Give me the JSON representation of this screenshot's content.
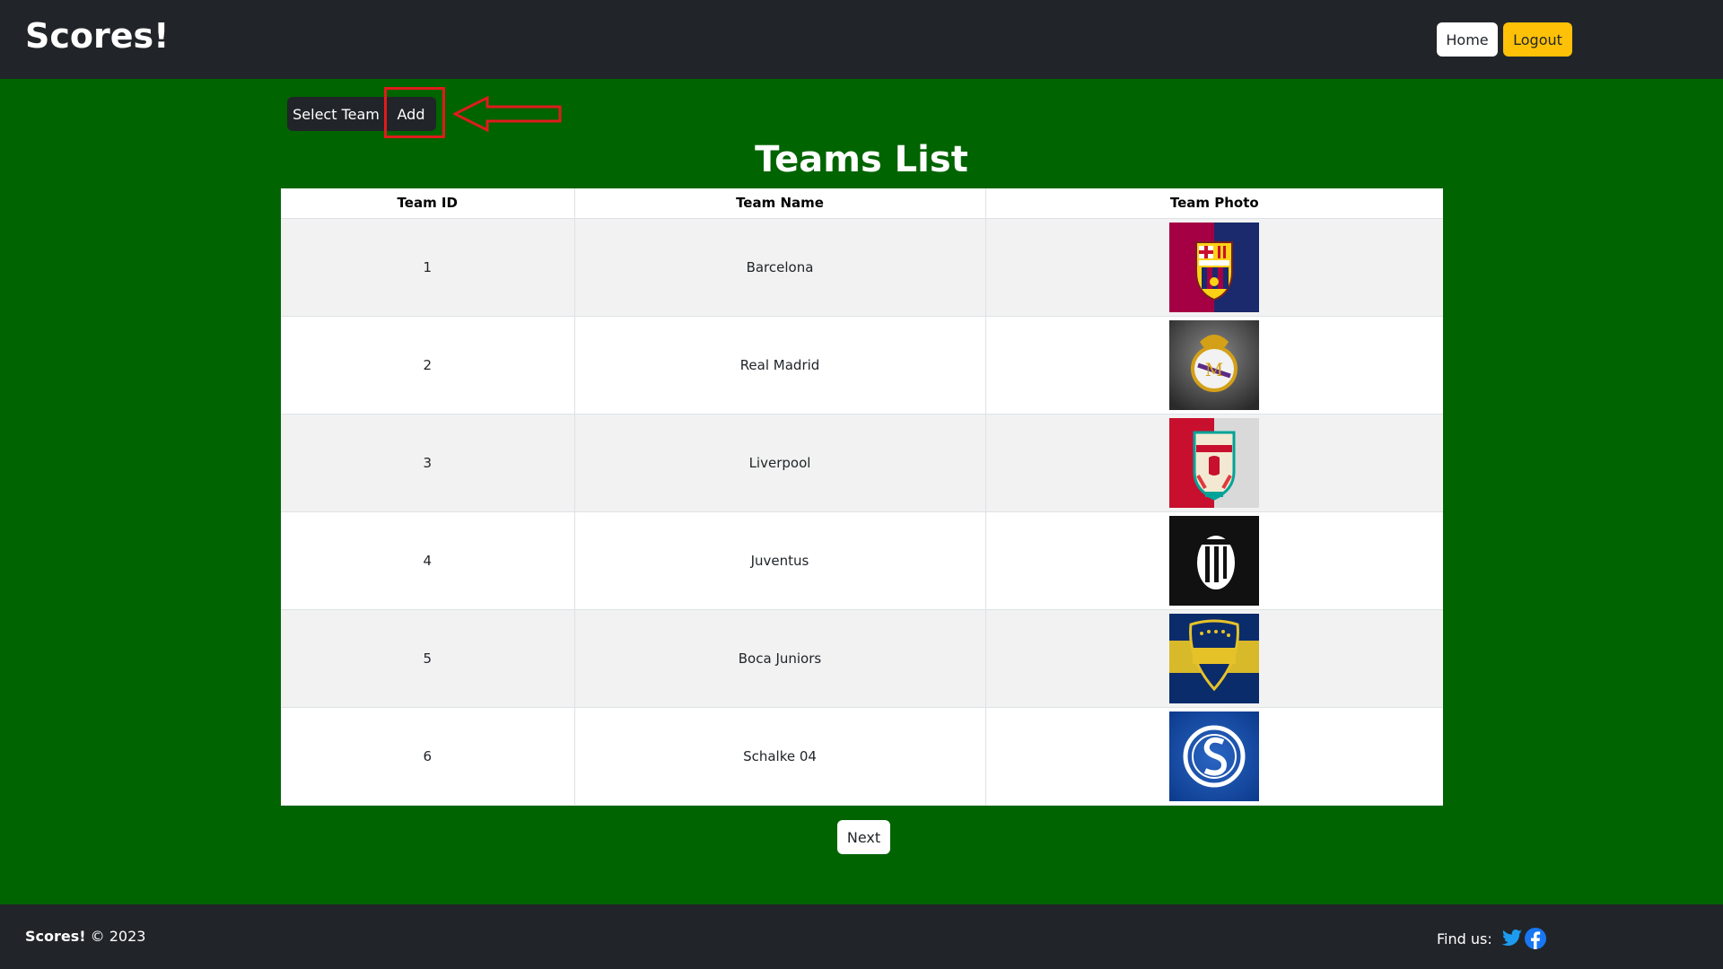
{
  "navbar": {
    "brand": "Scores!",
    "home_label": "Home",
    "logout_label": "Logout"
  },
  "toolbar": {
    "select_team_label": "Select Team",
    "add_label": "Add"
  },
  "page": {
    "title": "Teams List"
  },
  "table": {
    "headers": [
      "Team ID",
      "Team Name",
      "Team Photo"
    ],
    "rows": [
      {
        "id": "1",
        "name": "Barcelona",
        "photo_icon": "barcelona-crest-icon"
      },
      {
        "id": "2",
        "name": "Real Madrid",
        "photo_icon": "real-madrid-crest-icon"
      },
      {
        "id": "3",
        "name": "Liverpool",
        "photo_icon": "liverpool-crest-icon"
      },
      {
        "id": "4",
        "name": "Juventus",
        "photo_icon": "juventus-crest-icon"
      },
      {
        "id": "5",
        "name": "Boca Juniors",
        "photo_icon": "boca-juniors-crest-icon"
      },
      {
        "id": "6",
        "name": "Schalke 04",
        "photo_icon": "schalke-crest-icon"
      }
    ]
  },
  "pagination": {
    "next_label": "Next"
  },
  "footer": {
    "brand": "Scores!",
    "copyright": "© 2023",
    "find_us_label": "Find us:",
    "social_icons": [
      "twitter-icon",
      "facebook-icon"
    ]
  },
  "colors": {
    "navbar_bg": "#212529",
    "page_bg": "#006400",
    "logout_bg": "#ffc107",
    "highlight": "#e01b1b"
  }
}
